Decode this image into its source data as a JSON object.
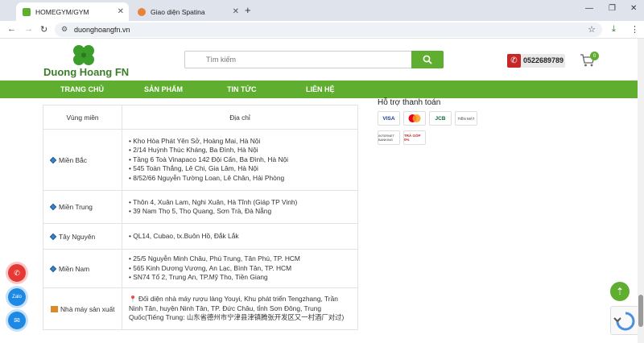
{
  "browser": {
    "tabs": [
      {
        "title": "HOMEGYM/GYM",
        "active": true
      },
      {
        "title": "Giao diện Spatina",
        "active": false
      }
    ],
    "url": "duonghoangfn.vn"
  },
  "header": {
    "logo_text": "Duong Hoang FN",
    "search_placeholder": "Tìm kiếm",
    "phone": "0522689789",
    "cart_count": "0"
  },
  "nav": {
    "items": [
      "TRANG CHỦ",
      "SẢN PHẨM",
      "TIN TỨC",
      "LIÊN HỆ"
    ]
  },
  "table": {
    "headers": [
      "Vùng miền",
      "Địa chỉ"
    ],
    "rows": [
      {
        "region": "Miền Bắc",
        "lines": [
          "• Kho Hòa Phát Yên Sở, Hoàng Mai, Hà Nội",
          "• 2/14 Huỳnh Thúc Kháng, Ba Đình, Hà Nội",
          "• Tầng 6 Toà Vinapaco 142 Đội Cấn, Ba Đình, Hà Nội",
          "• 545 Toàn Thắng, Lê Chi, Gia Lâm, Hà Nội",
          "• 8/52/66 Nguyễn Tường Loan, Lê Chân, Hải Phòng"
        ]
      },
      {
        "region": "Miền Trung",
        "lines": [
          "• Thôn 4, Xuân Lam, Nghi Xuân, Hà Tĩnh (Giáp TP Vinh)",
          "• 39 Nam Thọ 5, Thọ Quang, Sơn Trà, Đà Nẵng"
        ]
      },
      {
        "region": "Tây Nguyên",
        "lines": [
          "• QL14, Cubao, tx.Buôn Hồ, Đắk Lắk"
        ]
      },
      {
        "region": "Miền Nam",
        "lines": [
          "• 25/5 Nguyễn Minh Châu, Phú Trung, Tân Phú, TP. HCM",
          "• 565 Kinh Dương Vương, An Lạc, Bình Tân, TP. HCM",
          "• SN74 Tổ 2, Trung An, TP.Mỹ Tho, Tiền Giang"
        ]
      },
      {
        "region": "Nhà máy sản xuất",
        "lines": [
          "Đối diện nhà máy rượu làng Youyi, Khu phát triển Tengzhang, Trần Ninh Tân, huyện Ninh Tân, TP. Đức Châu, tỉnh Sơn Đông, Trung Quốc(Tiếng Trung: 山东省德州市宁津县津镇腾张开发区又一村酒厂对过)"
        ]
      }
    ]
  },
  "sidebar": {
    "support_title": "Hỗ trợ thanh toán",
    "payments": [
      "VISA",
      "Mastercard",
      "JCB",
      "TIỀN MẶT",
      "INTERNET BANKING",
      "TRẢ GÓP 0%"
    ]
  },
  "colors": {
    "brand_green": "#5fae2f",
    "phone_red": "#c62828"
  }
}
